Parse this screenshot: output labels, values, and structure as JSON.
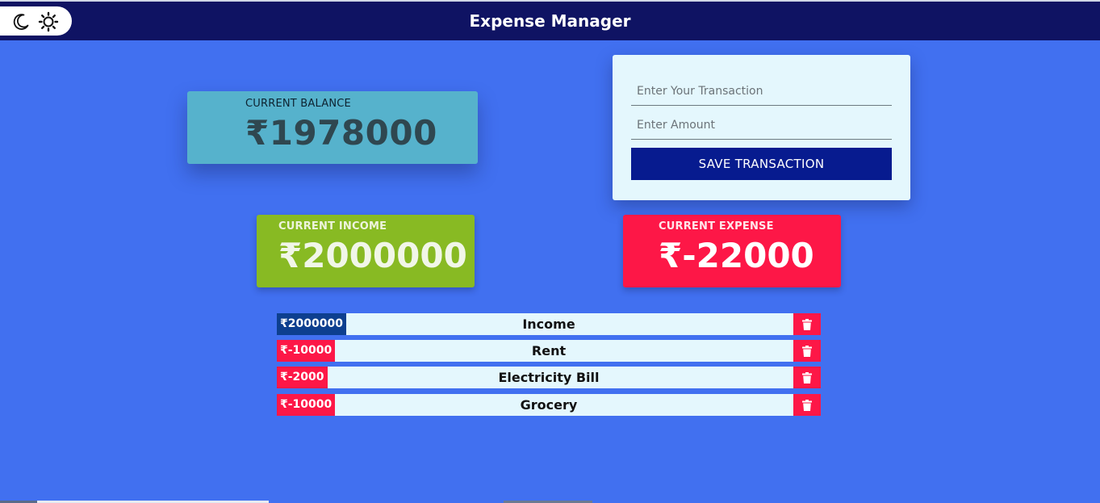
{
  "app": {
    "title": "Expense Manager"
  },
  "theme_toggle": {
    "icons": [
      "moon-icon",
      "sun-icon"
    ]
  },
  "balance": {
    "label": "CURRENT BALANCE",
    "amount": "₹1978000"
  },
  "form": {
    "transaction_placeholder": "Enter Your Transaction",
    "transaction_value": "",
    "amount_placeholder": "Enter Amount",
    "amount_value": "",
    "save_label": "SAVE TRANSACTION"
  },
  "income": {
    "label": "CURRENT INCOME",
    "amount": "₹2000000"
  },
  "expense": {
    "label": "CURRENT EXPENSE",
    "amount": "₹-22000"
  },
  "transactions": [
    {
      "amount": "₹2000000",
      "name": "Income",
      "type": "income"
    },
    {
      "amount": "₹-10000",
      "name": "Rent",
      "type": "expense"
    },
    {
      "amount": "₹-2000",
      "name": "Electricity Bill",
      "type": "expense"
    },
    {
      "amount": "₹-10000",
      "name": "Grocery",
      "type": "expense"
    }
  ],
  "colors": {
    "background": "#4170f0",
    "header": "#0f1363",
    "balance_card": "#56b2cc",
    "income_card": "#88ba23",
    "expense_card": "#fd1747",
    "save_button": "#071b8f",
    "income_badge": "#0d3f8f"
  }
}
